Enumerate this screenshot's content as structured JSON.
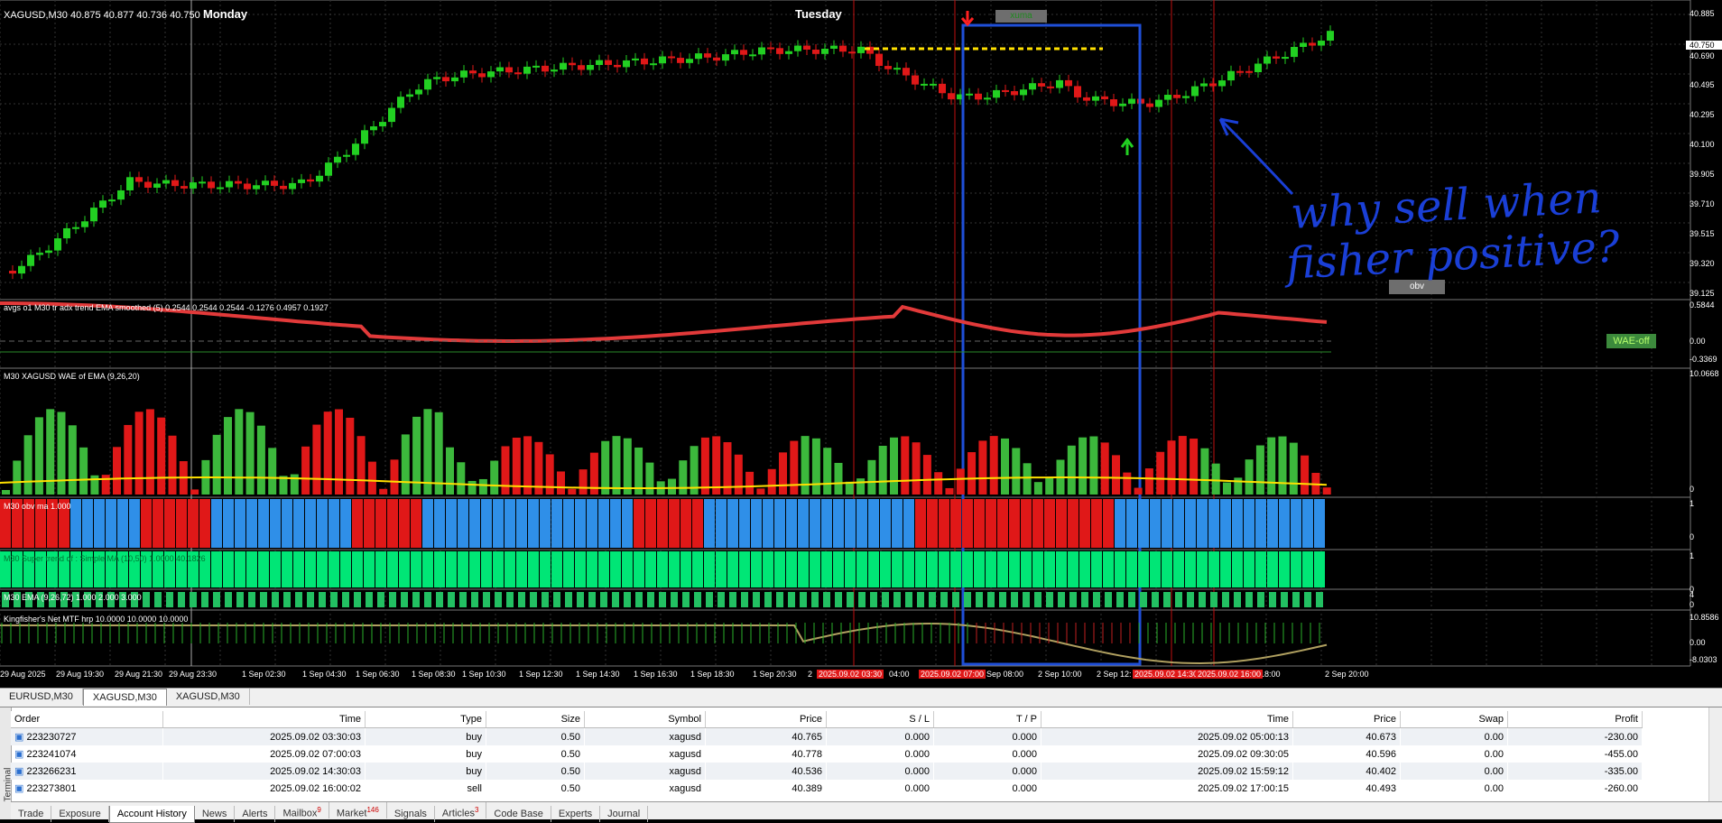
{
  "window_title": "XAGUSD,M30  40.875 40.877 40.736 40.750",
  "day_labels": [
    "Monday",
    "Tuesday"
  ],
  "price_axis": [
    "40.885",
    "40.750",
    "40.690",
    "40.495",
    "40.295",
    "40.100",
    "39.905",
    "39.710",
    "39.515",
    "39.320",
    "39.125"
  ],
  "indicators": {
    "avgs_title": "avgs o1 M30 tr adx trend EMA smoothed (5) 0.2544 0.2544 0.2544 -0.1276 0.4957 0.1927",
    "avgs_axis": [
      "0.5844",
      "0.00",
      "-0.3369"
    ],
    "wae_title": "M30 XAGUSD WAE of EMA (9,26,20)",
    "wae_axis": [
      "10.0668",
      "0"
    ],
    "wae_badge": "WAE-off",
    "obv_title": "M30 obv ma 1.000",
    "obv_axis": [
      "1",
      "0"
    ],
    "supertrend_title": "M30  Super trend of : Simple MA (10,50) 1.0000 40.1826",
    "supertrend_axis": [
      "1",
      "0"
    ],
    "ema_title": "M30 EMA (9,26,72) 1.000 2.000 3.000",
    "ema_axis": [
      "4",
      "0"
    ],
    "kingfisher_title": "Kingfisher's Net MTF hrp 10.0000 10.0000 10.0000",
    "kingfisher_axis": [
      "10.8586",
      "0.00",
      "-8.0303"
    ]
  },
  "badges": {
    "xuma": "xuma",
    "obv": "obv"
  },
  "annotation": {
    "line1": "why sell when",
    "line2": "fisher positive?"
  },
  "time_axis": [
    "29 Aug 2025",
    "29 Aug 19:30",
    "29 Aug 21:30",
    "29 Aug 23:30",
    "1 Sep 02:30",
    "1 Sep 04:30",
    "1 Sep 06:30",
    "1 Sep 08:30",
    "1 Sep 10:30",
    "1 Sep 12:30",
    "1 Sep 14:30",
    "1 Sep 16:30",
    "1 Sep 18:30",
    "1 Sep 20:30",
    "2",
    "04:00",
    "Sep 08:00",
    "2 Sep 10:00",
    "2 Sep 12:",
    "00",
    "2 Sep 18:00",
    "2 Sep 20:00"
  ],
  "time_highlights": [
    "2025.09.02 03:30",
    "2025.09.02 07:00",
    "2025.09.02 14:30",
    "2025.09.02 16:00"
  ],
  "chart_tabs": [
    "EURUSD,M30",
    "XAGUSD,M30",
    "XAGUSD,M30"
  ],
  "history": {
    "headers": [
      "Order",
      "Time",
      "Type",
      "Size",
      "Symbol",
      "Price",
      "S / L",
      "T / P",
      "Time",
      "Price",
      "Swap",
      "Profit"
    ],
    "rows": [
      [
        "223230727",
        "2025.09.02 03:30:03",
        "buy",
        "0.50",
        "xagusd",
        "40.765",
        "0.000",
        "0.000",
        "2025.09.02 05:00:13",
        "40.673",
        "0.00",
        "-230.00"
      ],
      [
        "223241074",
        "2025.09.02 07:00:03",
        "buy",
        "0.50",
        "xagusd",
        "40.778",
        "0.000",
        "0.000",
        "2025.09.02 09:30:05",
        "40.596",
        "0.00",
        "-455.00"
      ],
      [
        "223266231",
        "2025.09.02 14:30:03",
        "buy",
        "0.50",
        "xagusd",
        "40.536",
        "0.000",
        "0.000",
        "2025.09.02 15:59:12",
        "40.402",
        "0.00",
        "-335.00"
      ],
      [
        "223273801",
        "2025.09.02 16:00:02",
        "sell",
        "0.50",
        "xagusd",
        "40.389",
        "0.000",
        "0.000",
        "2025.09.02 17:00:15",
        "40.493",
        "0.00",
        "-260.00"
      ]
    ]
  },
  "terminal_label": "Terminal",
  "bottom_tabs": [
    {
      "label": "Trade",
      "badge": ""
    },
    {
      "label": "Exposure",
      "badge": ""
    },
    {
      "label": "Account History",
      "badge": ""
    },
    {
      "label": "News",
      "badge": ""
    },
    {
      "label": "Alerts",
      "badge": ""
    },
    {
      "label": "Mailbox",
      "badge": "9"
    },
    {
      "label": "Market",
      "badge": "146"
    },
    {
      "label": "Signals",
      "badge": ""
    },
    {
      "label": "Articles",
      "badge": "3"
    },
    {
      "label": "Code Base",
      "badge": ""
    },
    {
      "label": "Experts",
      "badge": ""
    },
    {
      "label": "Journal",
      "badge": ""
    }
  ],
  "colors": {
    "bull": "#22d022",
    "bear": "#e01818",
    "obv_blue": "#2f8fe8",
    "supertrend": "#00e676",
    "annotation": "#1a3fd6",
    "highlight_box": "#1f4fd8"
  }
}
